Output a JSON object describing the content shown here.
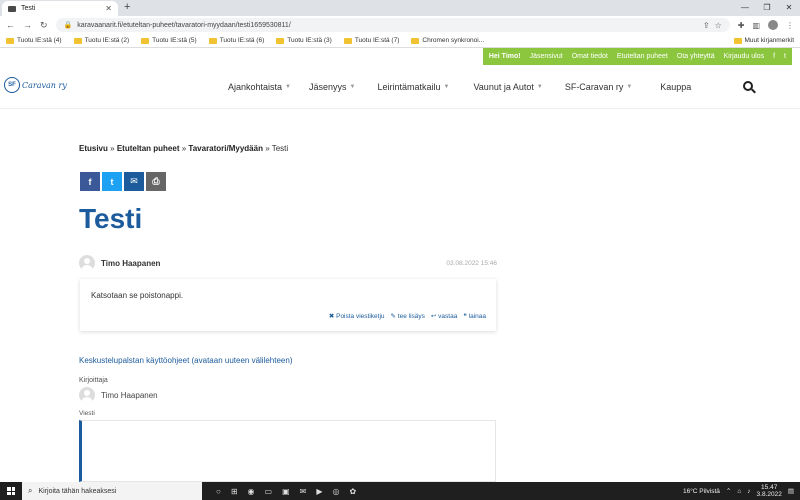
{
  "browser": {
    "tab_title": "Testi",
    "new_tab": "+",
    "url": "karavaanarit.fi/etuteltan-puheet/tavaratori-myydaan/testi1659530811/",
    "window_controls": [
      "—",
      "❐",
      "✕"
    ],
    "bookmarks": [
      "Tuotu IE:stä (4)",
      "Tuotu IE:stä (2)",
      "Tuotu IE:stä (5)",
      "Tuotu IE:stä (6)",
      "Tuotu IE:stä (3)",
      "Tuotu IE:stä (7)",
      "Chromen synkronoi..."
    ],
    "bookmarks_other": "Muut kirjanmerkit"
  },
  "topbar": {
    "greeting": "Hei Timo!",
    "links": [
      "Jäsensivut",
      "Omat tiedot",
      "Etuteltan puheet",
      "Ota yhteyttä",
      "Kirjaudu ulos"
    ]
  },
  "logo": {
    "mark": "SF",
    "text": "Caravan ry"
  },
  "nav": {
    "items": [
      {
        "label": "Ajankohtaista",
        "has_dropdown": true
      },
      {
        "label": "Jäsenyys",
        "has_dropdown": true
      },
      {
        "label": "Leirintämatkailu",
        "has_dropdown": true
      },
      {
        "label": "Vaunut ja Autot",
        "has_dropdown": true
      },
      {
        "label": "SF-Caravan ry",
        "has_dropdown": true
      },
      {
        "label": "Kauppa",
        "has_dropdown": false
      }
    ]
  },
  "breadcrumb": {
    "items": [
      "Etusivu",
      "Etuteltan puheet",
      "Tavaratori/Myydään"
    ],
    "current": "Testi",
    "separator": "»"
  },
  "share": {
    "fb": "f",
    "tw": "t",
    "mail": "✉",
    "print": "⎙"
  },
  "post": {
    "title": "Testi",
    "author": "Timo Haapanen",
    "date": "03.08.2022 15:46",
    "text": "Katsotaan se poistonappi.",
    "actions": [
      "Poista viestiketju",
      "tee lisäys",
      "vastaa",
      "lainaa"
    ]
  },
  "form": {
    "help_link": "Keskustelupalstan käyttöohjeet (avataan uuteen välilehteen)",
    "author_label": "Kirjoittaja",
    "author_name": "Timo Haapanen",
    "message_label": "Viesti"
  },
  "taskbar": {
    "search_placeholder": "Kirjoita tähän hakeaksesi",
    "weather": "16°C  Pilvistä",
    "time": "15.47",
    "date": "3.8.2022"
  },
  "colors": {
    "brand_blue": "#1c5b9c",
    "green": "#8cc63f"
  }
}
